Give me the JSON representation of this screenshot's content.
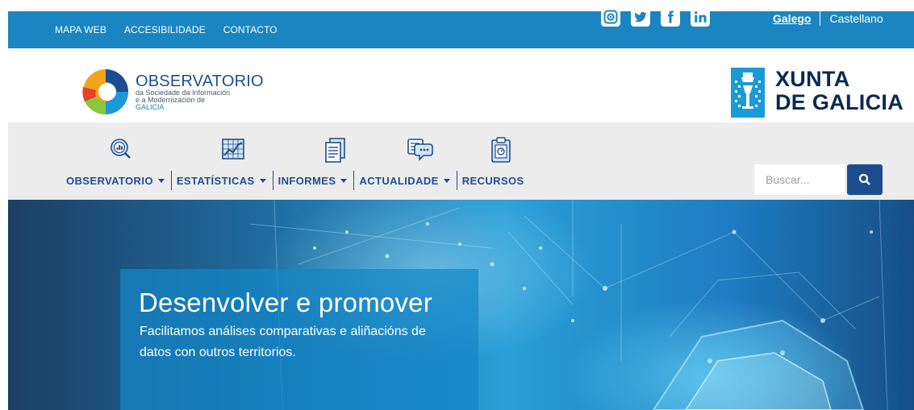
{
  "topbar": {
    "links": [
      "MAPA WEB",
      "ACCESIBILIDADE",
      "CONTACTO"
    ],
    "social": [
      "instagram-icon",
      "twitter-icon",
      "facebook-icon",
      "linkedin-icon"
    ],
    "lang_active": "Galego",
    "lang_other": "Castellano"
  },
  "header": {
    "obs_title": "OBSERVATORIO",
    "obs_line1": "da Sociedade da Información",
    "obs_line2": "e a Modernización de",
    "obs_line3": "GALICIA",
    "xunta_line1": "XUNTA",
    "xunta_line2": "DE GALICIA"
  },
  "nav": {
    "items": [
      {
        "label": "OBSERVATORIO",
        "icon": "magnifier-chart-icon",
        "dropdown": true
      },
      {
        "label": "ESTATÍSTICAS",
        "icon": "line-chart-icon",
        "dropdown": true
      },
      {
        "label": "INFORMES",
        "icon": "documents-icon",
        "dropdown": true
      },
      {
        "label": "ACTUALIDADE",
        "icon": "chat-bubbles-icon",
        "dropdown": true
      },
      {
        "label": "RECURSOS",
        "icon": "clipboard-icon",
        "dropdown": false
      }
    ]
  },
  "search": {
    "placeholder": "Buscar..."
  },
  "hero": {
    "title": "Desenvolver e promover",
    "subtitle": "Facilitamos análises comparativas e aliñacións de datos con outros territorios."
  },
  "colors": {
    "topbar": "#1a85c0",
    "navy": "#1e4d8f",
    "navband": "#ececec"
  }
}
